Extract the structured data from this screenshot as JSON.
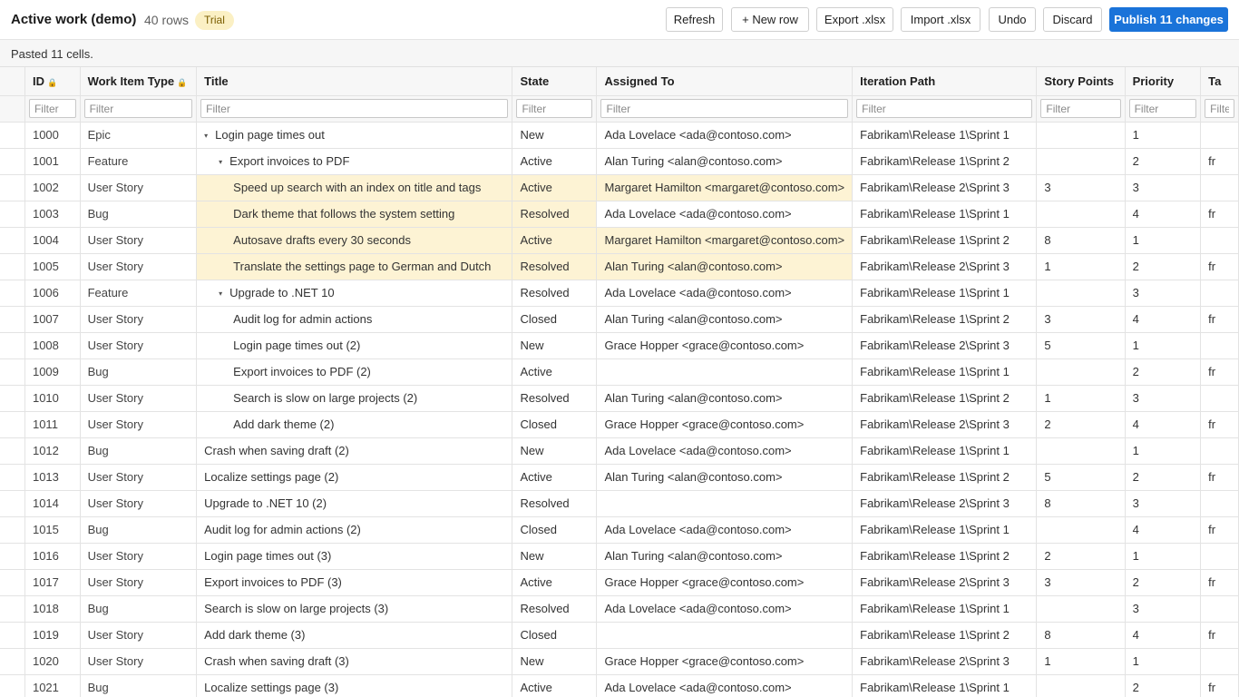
{
  "header": {
    "title": "Active work (demo)",
    "row_count": "40 rows",
    "badge": "Trial",
    "buttons": {
      "refresh": "Refresh",
      "new_row": "+ New row",
      "export": "Export .xlsx",
      "import": "Import .xlsx",
      "undo": "Undo",
      "discard": "Discard",
      "publish": "Publish 11 changes"
    }
  },
  "status": {
    "message": "Pasted 11 cells."
  },
  "grid": {
    "filter_placeholder": "Filter",
    "columns": [
      {
        "key": "id",
        "label": "ID",
        "locked": true
      },
      {
        "key": "type",
        "label": "Work Item Type",
        "locked": true
      },
      {
        "key": "title",
        "label": "Title",
        "locked": false
      },
      {
        "key": "state",
        "label": "State",
        "locked": false
      },
      {
        "key": "assigned",
        "label": "Assigned To",
        "locked": false
      },
      {
        "key": "iteration",
        "label": "Iteration Path",
        "locked": false
      },
      {
        "key": "points",
        "label": "Story Points",
        "locked": false
      },
      {
        "key": "priority",
        "label": "Priority",
        "locked": false
      },
      {
        "key": "tags",
        "label": "Ta",
        "locked": false
      }
    ],
    "rows": [
      {
        "id": "1000",
        "type": "Epic",
        "title": "Login page times out",
        "level": 0,
        "collapsible": true,
        "state": "New",
        "assigned": "Ada Lovelace <ada@contoso.com>",
        "iteration": "Fabrikam\\Release 1\\Sprint 1",
        "points": "",
        "priority": "1",
        "tags": "",
        "edited": []
      },
      {
        "id": "1001",
        "type": "Feature",
        "title": "Export invoices to PDF",
        "level": 1,
        "collapsible": true,
        "state": "Active",
        "assigned": "Alan Turing <alan@contoso.com>",
        "iteration": "Fabrikam\\Release 1\\Sprint 2",
        "points": "",
        "priority": "2",
        "tags": "fr",
        "edited": []
      },
      {
        "id": "1002",
        "type": "User Story",
        "title": "Speed up search with an index on title and tags",
        "level": 2,
        "collapsible": false,
        "state": "Active",
        "assigned": "Margaret Hamilton <margaret@contoso.com>",
        "iteration": "Fabrikam\\Release 2\\Sprint 3",
        "points": "3",
        "priority": "3",
        "tags": "",
        "edited": [
          "title",
          "state",
          "assigned"
        ]
      },
      {
        "id": "1003",
        "type": "Bug",
        "title": "Dark theme that follows the system setting",
        "level": 2,
        "collapsible": false,
        "state": "Resolved",
        "assigned": "Ada Lovelace <ada@contoso.com>",
        "iteration": "Fabrikam\\Release 1\\Sprint 1",
        "points": "",
        "priority": "4",
        "tags": "fr",
        "edited": [
          "title",
          "state"
        ]
      },
      {
        "id": "1004",
        "type": "User Story",
        "title": "Autosave drafts every 30 seconds",
        "level": 2,
        "collapsible": false,
        "state": "Active",
        "assigned": "Margaret Hamilton <margaret@contoso.com>",
        "iteration": "Fabrikam\\Release 1\\Sprint 2",
        "points": "8",
        "priority": "1",
        "tags": "",
        "edited": [
          "title",
          "state",
          "assigned"
        ]
      },
      {
        "id": "1005",
        "type": "User Story",
        "title": "Translate the settings page to German and Dutch",
        "level": 2,
        "collapsible": false,
        "state": "Resolved",
        "assigned": "Alan Turing <alan@contoso.com>",
        "iteration": "Fabrikam\\Release 2\\Sprint 3",
        "points": "1",
        "priority": "2",
        "tags": "fr",
        "edited": [
          "title",
          "state",
          "assigned"
        ]
      },
      {
        "id": "1006",
        "type": "Feature",
        "title": "Upgrade to .NET 10",
        "level": 1,
        "collapsible": true,
        "state": "Resolved",
        "assigned": "Ada Lovelace <ada@contoso.com>",
        "iteration": "Fabrikam\\Release 1\\Sprint 1",
        "points": "",
        "priority": "3",
        "tags": "",
        "edited": []
      },
      {
        "id": "1007",
        "type": "User Story",
        "title": "Audit log for admin actions",
        "level": 2,
        "collapsible": false,
        "state": "Closed",
        "assigned": "Alan Turing <alan@contoso.com>",
        "iteration": "Fabrikam\\Release 1\\Sprint 2",
        "points": "3",
        "priority": "4",
        "tags": "fr",
        "edited": []
      },
      {
        "id": "1008",
        "type": "User Story",
        "title": "Login page times out (2)",
        "level": 2,
        "collapsible": false,
        "state": "New",
        "assigned": "Grace Hopper <grace@contoso.com>",
        "iteration": "Fabrikam\\Release 2\\Sprint 3",
        "points": "5",
        "priority": "1",
        "tags": "",
        "edited": []
      },
      {
        "id": "1009",
        "type": "Bug",
        "title": "Export invoices to PDF (2)",
        "level": 2,
        "collapsible": false,
        "state": "Active",
        "assigned": "",
        "iteration": "Fabrikam\\Release 1\\Sprint 1",
        "points": "",
        "priority": "2",
        "tags": "fr",
        "edited": []
      },
      {
        "id": "1010",
        "type": "User Story",
        "title": "Search is slow on large projects (2)",
        "level": 2,
        "collapsible": false,
        "state": "Resolved",
        "assigned": "Alan Turing <alan@contoso.com>",
        "iteration": "Fabrikam\\Release 1\\Sprint 2",
        "points": "1",
        "priority": "3",
        "tags": "",
        "edited": []
      },
      {
        "id": "1011",
        "type": "User Story",
        "title": "Add dark theme (2)",
        "level": 2,
        "collapsible": false,
        "state": "Closed",
        "assigned": "Grace Hopper <grace@contoso.com>",
        "iteration": "Fabrikam\\Release 2\\Sprint 3",
        "points": "2",
        "priority": "4",
        "tags": "fr",
        "edited": []
      },
      {
        "id": "1012",
        "type": "Bug",
        "title": "Crash when saving draft (2)",
        "level": 0,
        "collapsible": false,
        "state": "New",
        "assigned": "Ada Lovelace <ada@contoso.com>",
        "iteration": "Fabrikam\\Release 1\\Sprint 1",
        "points": "",
        "priority": "1",
        "tags": "",
        "edited": []
      },
      {
        "id": "1013",
        "type": "User Story",
        "title": "Localize settings page (2)",
        "level": 0,
        "collapsible": false,
        "state": "Active",
        "assigned": "Alan Turing <alan@contoso.com>",
        "iteration": "Fabrikam\\Release 1\\Sprint 2",
        "points": "5",
        "priority": "2",
        "tags": "fr",
        "edited": []
      },
      {
        "id": "1014",
        "type": "User Story",
        "title": "Upgrade to .NET 10 (2)",
        "level": 0,
        "collapsible": false,
        "state": "Resolved",
        "assigned": "",
        "iteration": "Fabrikam\\Release 2\\Sprint 3",
        "points": "8",
        "priority": "3",
        "tags": "",
        "edited": []
      },
      {
        "id": "1015",
        "type": "Bug",
        "title": "Audit log for admin actions (2)",
        "level": 0,
        "collapsible": false,
        "state": "Closed",
        "assigned": "Ada Lovelace <ada@contoso.com>",
        "iteration": "Fabrikam\\Release 1\\Sprint 1",
        "points": "",
        "priority": "4",
        "tags": "fr",
        "edited": []
      },
      {
        "id": "1016",
        "type": "User Story",
        "title": "Login page times out (3)",
        "level": 0,
        "collapsible": false,
        "state": "New",
        "assigned": "Alan Turing <alan@contoso.com>",
        "iteration": "Fabrikam\\Release 1\\Sprint 2",
        "points": "2",
        "priority": "1",
        "tags": "",
        "edited": []
      },
      {
        "id": "1017",
        "type": "User Story",
        "title": "Export invoices to PDF (3)",
        "level": 0,
        "collapsible": false,
        "state": "Active",
        "assigned": "Grace Hopper <grace@contoso.com>",
        "iteration": "Fabrikam\\Release 2\\Sprint 3",
        "points": "3",
        "priority": "2",
        "tags": "fr",
        "edited": []
      },
      {
        "id": "1018",
        "type": "Bug",
        "title": "Search is slow on large projects (3)",
        "level": 0,
        "collapsible": false,
        "state": "Resolved",
        "assigned": "Ada Lovelace <ada@contoso.com>",
        "iteration": "Fabrikam\\Release 1\\Sprint 1",
        "points": "",
        "priority": "3",
        "tags": "",
        "edited": []
      },
      {
        "id": "1019",
        "type": "User Story",
        "title": "Add dark theme (3)",
        "level": 0,
        "collapsible": false,
        "state": "Closed",
        "assigned": "",
        "iteration": "Fabrikam\\Release 1\\Sprint 2",
        "points": "8",
        "priority": "4",
        "tags": "fr",
        "edited": []
      },
      {
        "id": "1020",
        "type": "User Story",
        "title": "Crash when saving draft (3)",
        "level": 0,
        "collapsible": false,
        "state": "New",
        "assigned": "Grace Hopper <grace@contoso.com>",
        "iteration": "Fabrikam\\Release 2\\Sprint 3",
        "points": "1",
        "priority": "1",
        "tags": "",
        "edited": []
      },
      {
        "id": "1021",
        "type": "Bug",
        "title": "Localize settings page (3)",
        "level": 0,
        "collapsible": false,
        "state": "Active",
        "assigned": "Ada Lovelace <ada@contoso.com>",
        "iteration": "Fabrikam\\Release 1\\Sprint 1",
        "points": "",
        "priority": "2",
        "tags": "fr",
        "edited": []
      }
    ]
  },
  "colors": {
    "accent": "#1a73d9",
    "badge_bg": "#fbf0c4",
    "edited_cell_bg": "#fdf3d4",
    "lock_icon": "#d98a1c"
  }
}
